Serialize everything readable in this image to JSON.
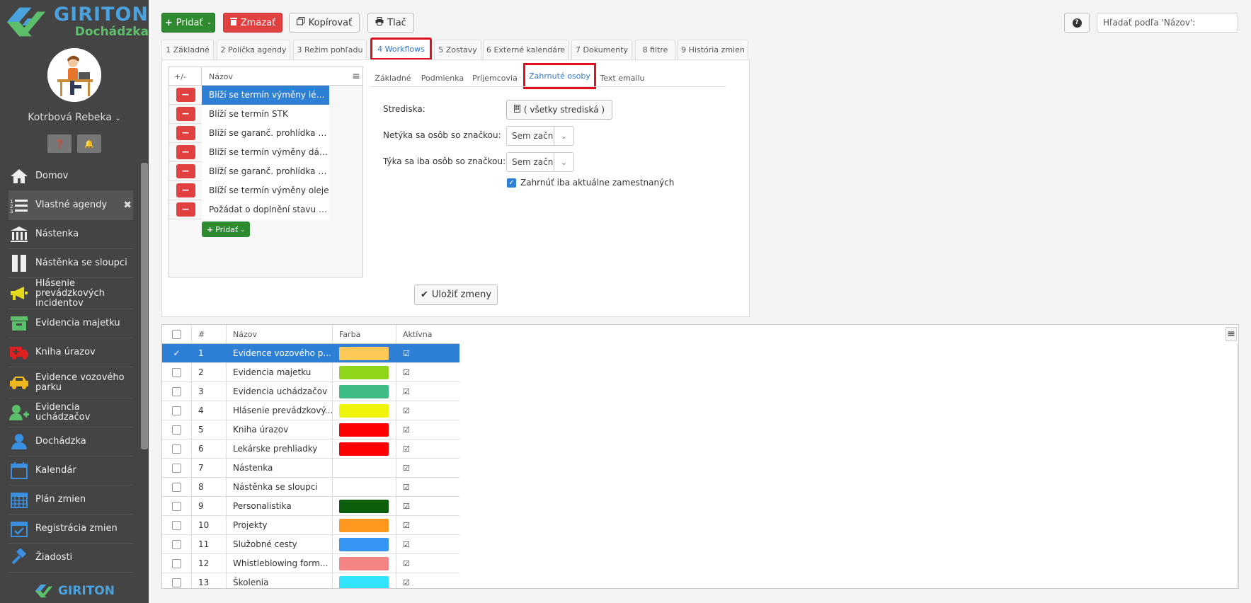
{
  "brand": {
    "name": "GIRITON",
    "product": "Dochádzka"
  },
  "user": {
    "name": "Kotrbová Rebeka"
  },
  "sidebar": {
    "items": [
      {
        "label": "Domov",
        "icon": "home-icon"
      },
      {
        "label": "Vlastné agendy",
        "icon": "list-icon",
        "active": true
      },
      {
        "label": "Nástenka",
        "icon": "bank-icon"
      },
      {
        "label": "Nástěnka se sloupci",
        "icon": "columns-icon"
      },
      {
        "label": "Hlásenie prevádzkových incidentov",
        "icon": "megaphone-icon"
      },
      {
        "label": "Evidencia majetku",
        "icon": "box-icon"
      },
      {
        "label": "Kniha úrazov",
        "icon": "ambulance-icon"
      },
      {
        "label": "Evidence vozového parku",
        "icon": "car-icon"
      },
      {
        "label": "Evidencia uchádzačov",
        "icon": "user-plus-icon"
      },
      {
        "label": "Dochádzka",
        "icon": "user-icon"
      },
      {
        "label": "Kalendár",
        "icon": "calendar-icon"
      },
      {
        "label": "Plán zmien",
        "icon": "calendar-grid-icon"
      },
      {
        "label": "Registrácia zmien",
        "icon": "calendar-check-icon"
      },
      {
        "label": "Žiadosti",
        "icon": "gavel-icon"
      }
    ],
    "footer": "GIRITON"
  },
  "toolbar": {
    "add": "Pridať",
    "delete": "Zmazať",
    "copy": "Kopírovať",
    "print": "Tlač",
    "help": "?",
    "search_placeholder": "Hľadať podľa 'Názov':"
  },
  "tabs": [
    "1 Základné",
    "2 Políčka agendy",
    "3 Režim pohľadu",
    "4 Workflows",
    "5 Zostavy",
    "6 Externé kalendáre",
    "7 Dokumenty",
    "8 filtre",
    "9 História zmien"
  ],
  "workflows": {
    "col_toggle": "+/-",
    "col_name": "Názov",
    "rows": [
      "Blíží se termín výměny léká...",
      "Blíží se termín STK",
      "Blíží se garanč. prohlídka v...",
      "Blíží se termín výměny dál...",
      "Blíží se garanč. prohlídka v...",
      "Blíží se termín výměny oleje",
      "Požádat o doplnění stavu t..."
    ],
    "add": "Pridať"
  },
  "subtabs": [
    "Základné",
    "Podmienka",
    "Príjemcovia",
    "Zahrnuté osoby",
    "Text emailu"
  ],
  "form": {
    "strediska_label": "Strediska:",
    "strediska_value": "( všetky strediská )",
    "netyka_label": "Netýka sa osôb so značkou:",
    "netyka_value": "Sem začnite",
    "tyka_label": "Týka sa iba osôb so značkou:",
    "tyka_value": "Sem začnite",
    "only_current_label": "Zahrnúť iba aktuálne zamestnaných",
    "only_current_checked": true,
    "save": "Uložiť zmeny"
  },
  "grid": {
    "headers": [
      "#",
      "Názov",
      "Farba",
      "Aktívna"
    ],
    "rows": [
      {
        "n": "1",
        "name": "Evidence vozového p...",
        "color": "#ffc95a",
        "selected": true
      },
      {
        "n": "2",
        "name": "Evidencia majetku",
        "color": "#8fd61a"
      },
      {
        "n": "3",
        "name": "Evidencia uchádzačov",
        "color": "#3dbd85"
      },
      {
        "n": "4",
        "name": "Hlásenie prevádzkový...",
        "color": "#eef50b"
      },
      {
        "n": "5",
        "name": "Kniha úrazov",
        "color": "#ff0000"
      },
      {
        "n": "6",
        "name": "Lekárske prehliadky",
        "color": "#ff0000"
      },
      {
        "n": "7",
        "name": "Nástenka",
        "color": ""
      },
      {
        "n": "8",
        "name": "Nástěnka se sloupci",
        "color": "#ffffff"
      },
      {
        "n": "9",
        "name": "Personalistika",
        "color": "#0b5e0b"
      },
      {
        "n": "10",
        "name": "Projekty",
        "color": "#ff981f"
      },
      {
        "n": "11",
        "name": "Služobné cesty",
        "color": "#3595f2"
      },
      {
        "n": "12",
        "name": "Whistleblowing form...",
        "color": "#f58585"
      },
      {
        "n": "13",
        "name": "Školenia",
        "color": "#2fe4fb"
      }
    ]
  }
}
